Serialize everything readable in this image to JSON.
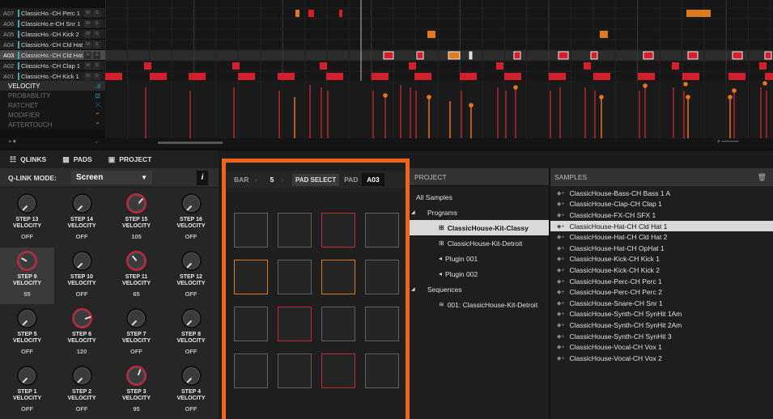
{
  "tracks": [
    {
      "id": "A07",
      "name": "ClassicHo.-CH Perc 1"
    },
    {
      "id": "A06",
      "name": "ClassicHo.e-CH Snr 1"
    },
    {
      "id": "A05",
      "name": "ClassicHo.-CH Kick 2"
    },
    {
      "id": "A04",
      "name": "ClassicHo.-CH Cld Hat 2"
    },
    {
      "id": "A03",
      "name": "ClassicHo.-CH Cld Hat 1"
    },
    {
      "id": "A02",
      "name": "ClassicHo.-CH Clap 1"
    },
    {
      "id": "A01",
      "name": "ClassicHo.-CH Kick 1"
    }
  ],
  "track_buttons": {
    "mute": "M",
    "solo": "S"
  },
  "lanes": [
    {
      "label": "VELOCITY",
      "icon": "bars-icon"
    },
    {
      "label": "PROBABILITY",
      "icon": "dice-icon"
    },
    {
      "label": "RATCHET",
      "icon": "ratchet-icon"
    },
    {
      "label": "MODIFIER",
      "icon": "modifier-icon"
    },
    {
      "label": "AFTERTOUCH",
      "icon": "aftertouch-icon"
    }
  ],
  "tabs": [
    {
      "label": "QLINKS",
      "icon": "qlinks-icon"
    },
    {
      "label": "PADS",
      "icon": "pads-icon"
    },
    {
      "label": "PROJECT",
      "icon": "project-icon"
    }
  ],
  "qlink": {
    "mode_label": "Q-LINK MODE:",
    "mode_value": "Screen",
    "info": "i",
    "knobs": [
      {
        "label": "STEP 13",
        "param": "VELOCITY",
        "value": "OFF"
      },
      {
        "label": "STEP 14",
        "param": "VELOCITY",
        "value": "OFF"
      },
      {
        "label": "STEP 15",
        "param": "VELOCITY",
        "value": "105"
      },
      {
        "label": "STEP 16",
        "param": "VELOCITY",
        "value": "OFF"
      },
      {
        "label": "STEP 9",
        "param": "VELOCITY",
        "value": "55"
      },
      {
        "label": "STEP 10",
        "param": "VELOCITY",
        "value": "OFF"
      },
      {
        "label": "STEP 11",
        "param": "VELOCITY",
        "value": "65"
      },
      {
        "label": "STEP 12",
        "param": "VELOCITY",
        "value": "OFF"
      },
      {
        "label": "STEP 5",
        "param": "VELOCITY",
        "value": "OFF"
      },
      {
        "label": "STEP 6",
        "param": "VELOCITY",
        "value": "120"
      },
      {
        "label": "STEP 7",
        "param": "VELOCITY",
        "value": "OFF"
      },
      {
        "label": "STEP 8",
        "param": "VELOCITY",
        "value": "OFF"
      },
      {
        "label": "STEP 1",
        "param": "VELOCITY",
        "value": "OFF"
      },
      {
        "label": "STEP 2",
        "param": "VELOCITY",
        "value": "OFF"
      },
      {
        "label": "STEP 3",
        "param": "VELOCITY",
        "value": "95"
      },
      {
        "label": "STEP 4",
        "param": "VELOCITY",
        "value": "OFF"
      }
    ]
  },
  "pad_bar": {
    "bar_label": "BAR",
    "bar_value": "5",
    "pad_select": "PAD SELECT",
    "pad_label": "PAD",
    "pad_value": "A03"
  },
  "pads": [
    "none",
    "none",
    "red",
    "none",
    "orange",
    "none",
    "orange",
    "none",
    "none",
    "red",
    "none",
    "none",
    "none",
    "none",
    "red",
    "none"
  ],
  "project": {
    "title": "PROJECT",
    "rows": [
      {
        "label": "All Samples",
        "icon": "",
        "indent": 0,
        "tri": false
      },
      {
        "label": "Programs",
        "icon": "",
        "indent": 1,
        "tri": true
      },
      {
        "label": "ClassicHouse-Kit-Classy",
        "icon": "program-icon",
        "indent": 2,
        "tri": false
      },
      {
        "label": "ClassicHouse-Kit-Detroit",
        "icon": "program-icon",
        "indent": 2,
        "tri": false
      },
      {
        "label": "Plugin 001",
        "icon": "plugin-icon",
        "indent": 2,
        "tri": false
      },
      {
        "label": "Plugin 002",
        "icon": "plugin-icon",
        "indent": 2,
        "tri": false
      },
      {
        "label": "Sequences",
        "icon": "",
        "indent": 1,
        "tri": true
      },
      {
        "label": "001: ClassicHouse-Kit-Detroit",
        "icon": "sequence-icon",
        "indent": 2,
        "tri": false
      }
    ],
    "selected": 2
  },
  "samples": {
    "title": "SAMPLES",
    "items": [
      "ClassicHouse-Bass-CH Bass 1 A",
      "ClassicHouse-Clap-CH Clap 1",
      "ClassicHouse-FX-CH SFX 1",
      "ClassicHouse-Hat-CH Cld Hat 1",
      "ClassicHouse-Hat-CH Cld Hat 2",
      "ClassicHouse-Hat-CH OpHat 1",
      "ClassicHouse-Kick-CH Kick 1",
      "ClassicHouse-Kick-CH Kick 2",
      "ClassicHouse-Perc-CH Perc 1",
      "ClassicHouse-Perc-CH Perc 2",
      "ClassicHouse-Snare-CH Snr 1",
      "ClassicHouse-Synth-CH SynHit 1Am",
      "ClassicHouse-Synth-CH SynHit 2Am",
      "ClassicHouse-Synth-CH SynHit 3",
      "ClassicHouse-Vocal-CH Vox 1",
      "ClassicHouse-Vocal-CH Vox 2"
    ],
    "selected": 3
  },
  "colors": {
    "accent": "#f0651c",
    "note_red": "#d21f2c",
    "note_orange": "#e07a20",
    "velocity_red": "#b8242e",
    "velocity_orange": "#e8731e"
  }
}
